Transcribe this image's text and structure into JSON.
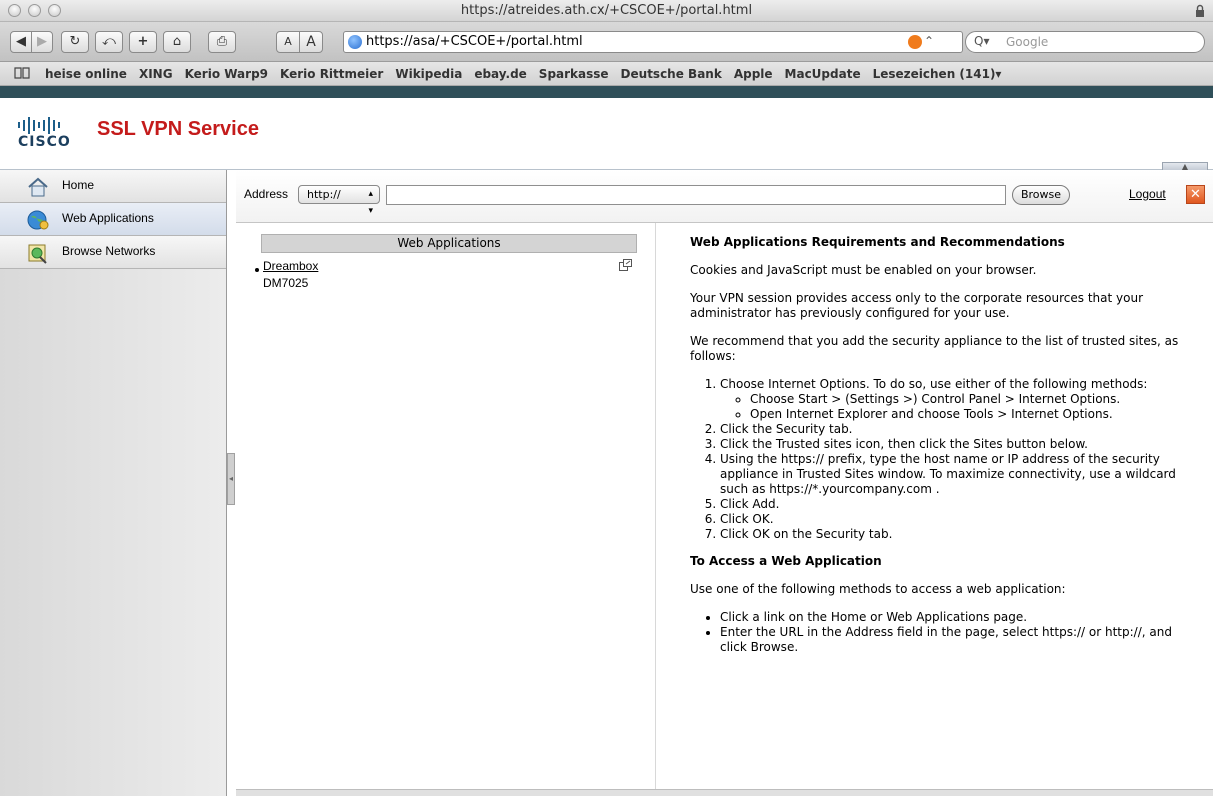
{
  "browser": {
    "window_title": "https://atreides.ath.cx/+CSCOE+/portal.html",
    "url": "https://asa/+CSCOE+/portal.html",
    "search_placeholder": "Google",
    "text_small": "A",
    "text_large": "A",
    "bookmarks": [
      "heise online",
      "XING",
      "Kerio Warp9",
      "Kerio Rittmeier",
      "Wikipedia",
      "ebay.de",
      "Sparkasse",
      "Deutsche Bank",
      "Apple",
      "MacUpdate",
      "Lesezeichen (141)▾"
    ]
  },
  "header": {
    "logo_text": "CISCO",
    "product_title": "SSL VPN Service"
  },
  "sidebar": {
    "items": [
      {
        "label": "Home",
        "icon": "home-icon"
      },
      {
        "label": "Web Applications",
        "icon": "web-applications-icon",
        "active": true
      },
      {
        "label": "Browse Networks",
        "icon": "browse-networks-icon"
      }
    ]
  },
  "addressbar": {
    "label": "Address",
    "protocol": "http://",
    "value": "",
    "browse_label": "Browse",
    "logout_label": "Logout"
  },
  "webapps": {
    "header": "Web Applications",
    "items": [
      {
        "name": "Dreambox",
        "description": "DM7025"
      }
    ]
  },
  "help": {
    "title1": "Web Applications Requirements and Recommendations",
    "p1": "Cookies and JavaScript must be enabled on your browser.",
    "p2": "Your VPN session provides access only to the corporate resources that your administrator has previously configured for your use.",
    "p3": "We recommend that you add the security appliance to the list of trusted sites, as follows:",
    "step1": "Choose Internet Options. To do so, use either of the following methods:",
    "step1a": "Choose Start > (Settings >) Control Panel > Internet Options.",
    "step1b": "Open Internet Explorer and choose Tools > Internet Options.",
    "step2": "Click the Security tab.",
    "step3": "Click the Trusted sites icon, then click the Sites button below.",
    "step4": "Using the https:// prefix, type the host name or IP address of the security appliance in Trusted Sites window. To maximize connectivity, use a wildcard such as https://*.yourcompany.com .",
    "step5": "Click Add.",
    "step6": "Click OK.",
    "step7": "Click OK on the Security tab.",
    "title2": "To Access a Web Application",
    "p4": "Use one of the following methods to access a web application:",
    "m1": "Click a link on the Home or Web Applications page.",
    "m2": "Enter the URL in the Address field in the page, select https:// or http://, and click Browse."
  }
}
